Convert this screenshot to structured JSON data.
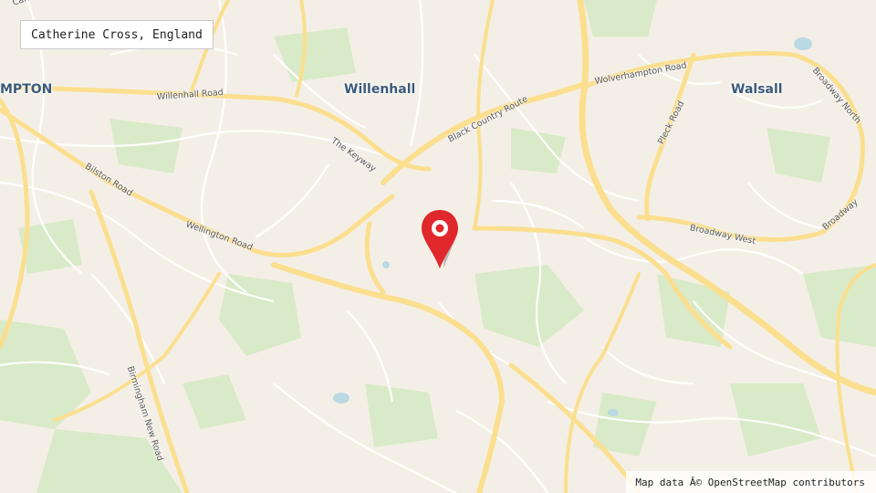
{
  "location": {
    "label": "Catherine Cross, England"
  },
  "places": {
    "wolverhampton": "MPTON",
    "willenhall": "Willenhall",
    "walsall": "Walsall"
  },
  "roads": {
    "top_left": "Cann",
    "willenhall_road": "Willenhall Road",
    "keyway": "The Keyway",
    "black_country_route": "Black Country Route",
    "wolverhampton_road": "Wolverhampton Road",
    "pleck_road": "Pleck Road",
    "broadway_north": "Broadway North",
    "bilston_road": "Bilston Road",
    "wellington_road": "Wellington Road",
    "broadway_west": "Broadway West",
    "broadway": "Broadway",
    "birmingham_new_road": "Birmingham New Road"
  },
  "marker": {
    "icon": "map-pin-icon",
    "color": "#e0282c"
  },
  "colors": {
    "land": "#f4efe6",
    "major_road": "#fbdf8f",
    "minor_road": "#ffffff",
    "green": "#d7e9c4",
    "water": "#aad3df"
  },
  "attribution": "Map data Â© OpenStreetMap contributors"
}
